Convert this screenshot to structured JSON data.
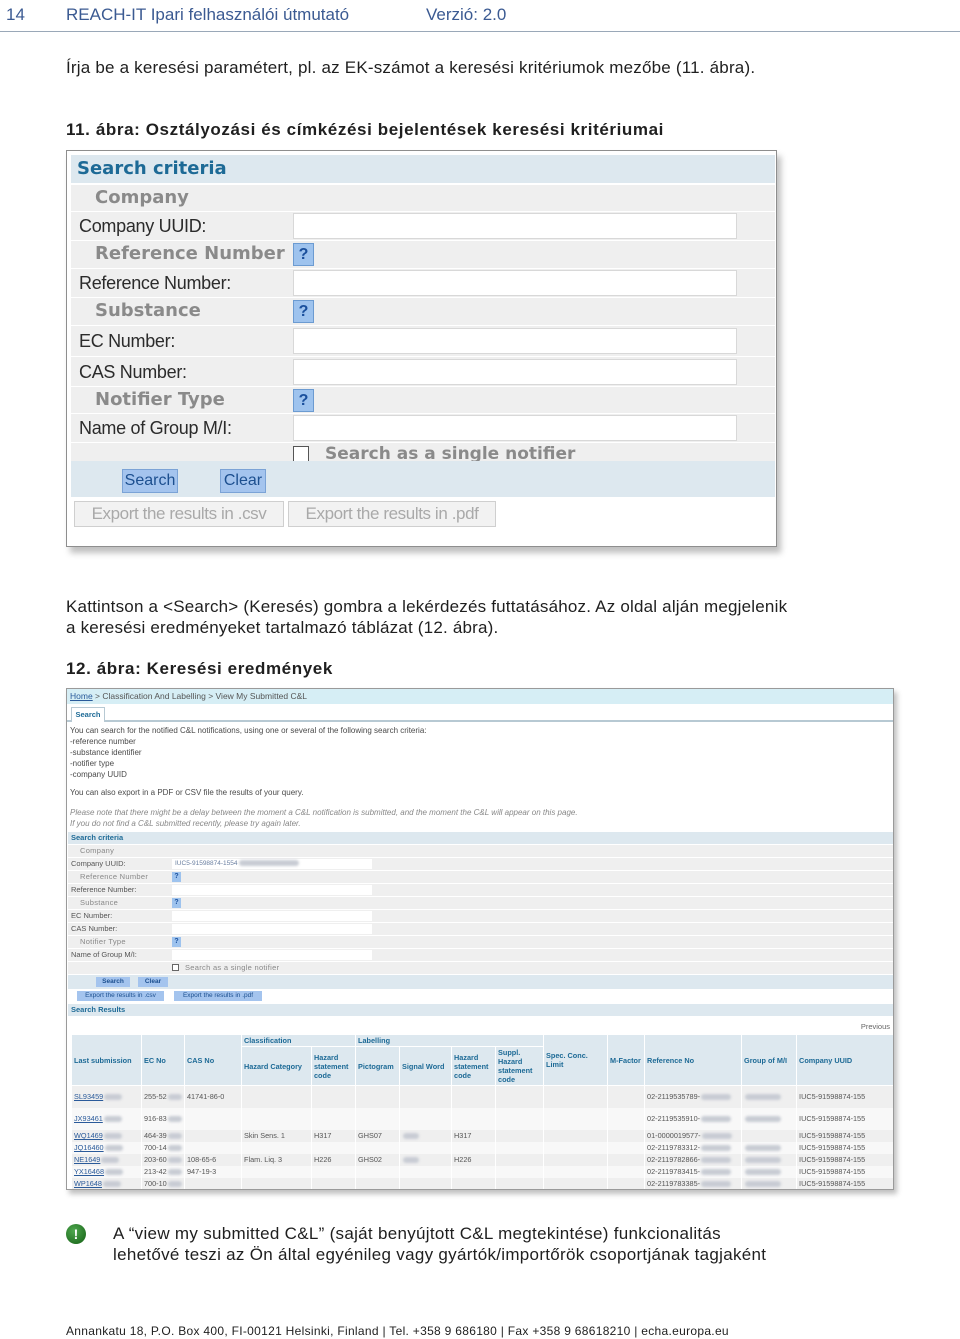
{
  "header": {
    "page_number": "14",
    "doc_title": "REACH-IT Ipari felhasználói útmutató",
    "version": "Verzió: 2.0"
  },
  "intro_text": "Írja be a keresési paramétert, pl. az EK-számot a keresési kritériumok mezőbe (11. ábra).",
  "figure11": {
    "caption": "11. ábra: Osztályozási és címkézési bejelentések keresési kritériumai",
    "title": "Search criteria",
    "sections": {
      "company": "Company",
      "reference": "Reference Number",
      "substance": "Substance",
      "notifier": "Notifier Type"
    },
    "labels": {
      "company_uuid": "Company UUID:",
      "reference_number": "Reference Number:",
      "ec_number": "EC Number:",
      "cas_number": "CAS Number:",
      "group_name": "Name of Group M/I:"
    },
    "values": {
      "company_uuid": "",
      "reference_number": "",
      "ec_number": "",
      "cas_number": "",
      "group_name": ""
    },
    "help_glyph": "?",
    "single_notifier_label": "Search as a single notifier",
    "single_notifier_checked": false,
    "search_button": "Search",
    "clear_button": "Clear",
    "export_csv": "Export the results in .csv",
    "export_pdf": "Export the results in .pdf"
  },
  "body_text": {
    "line1": "Kattintson a <Search> (Keresés) gombra a lekérdezés futtatásához. Az oldal alján megjelenik",
    "line2": "a keresési eredményeket tartalmazó táblázat (12. ábra)."
  },
  "figure12": {
    "caption": "12. ábra: Keresési eredmények",
    "breadcrumb": {
      "home": "Home",
      "rest": " > Classification And Labelling > View My Submitted C&L"
    },
    "tab": "Search",
    "intro_lines": [
      "You can search for the notified C&L notifications, using one or several of the following search criteria:",
      "-reference number",
      "-substance identifier",
      "-notifier type",
      "-company UUID"
    ],
    "export_note": "You can also export in a PDF or CSV file the results of your query.",
    "delay_note": [
      "Please note that there might be a delay between the moment a C&L notification is submitted, and the moment the C&L will appear on this page.",
      "If you do not find a C&L submitted recently, please try again later."
    ],
    "criteria": {
      "title": "Search criteria",
      "company": "Company",
      "company_uuid_label": "Company UUID:",
      "company_uuid_value": "IUC5-91598874-1554",
      "reference_section": "Reference Number",
      "reference_label": "Reference Number:",
      "substance_section": "Substance",
      "ec_label": "EC Number:",
      "cas_label": "CAS Number:",
      "notifier_section": "Notifier Type",
      "group_label": "Name of Group M/I:",
      "single_notifier": "Search as a single notifier",
      "search": "Search",
      "clear": "Clear",
      "export_csv": "Export the results in .csv",
      "export_pdf": "Export the results in .pdf",
      "help_glyph": "?"
    },
    "results": {
      "title": "Search Results",
      "previous": "Previous",
      "group_headers": {
        "classification": "Classification",
        "labelling": "Labelling"
      },
      "columns": [
        "Last submission",
        "EC No",
        "CAS No",
        "Hazard Category",
        "Hazard statement code",
        "Pictogram",
        "Signal Word",
        "Hazard statement code",
        "Suppl. Hazard statement code",
        "Spec. Conc. Limit",
        "M-Factor",
        "Reference No",
        "Group of M/I",
        "Company UUID"
      ],
      "rows": [
        {
          "last": "SL93459",
          "ec": "255-52",
          "cas": "41741-86-0",
          "hazcat": "",
          "hcode": "",
          "picto": "",
          "signal": "",
          "lcode": "",
          "suppl": "",
          "scl": "",
          "mf": "",
          "ref": "02-2119535789-",
          "group": "",
          "uuid": "IUC5-91598874-155"
        },
        {
          "last": "JX93461",
          "ec": "916-83",
          "cas": "",
          "hazcat": "",
          "hcode": "",
          "picto": "",
          "signal": "",
          "lcode": "",
          "suppl": "",
          "scl": "",
          "mf": "",
          "ref": "02-2119535910-",
          "group": "",
          "uuid": "IUC5-91598874-155"
        },
        {
          "last": "WQ1469",
          "ec": "464-39",
          "cas": "",
          "hazcat": "Skin Sens. 1",
          "hcode": "H317",
          "picto": "GHS07",
          "signal": "",
          "lcode": "H317",
          "suppl": "",
          "scl": "",
          "mf": "",
          "ref": "01-0000019577-",
          "group": "",
          "uuid": "IUC5-91598874-155"
        },
        {
          "last": "JQ16460",
          "ec": "700-14",
          "cas": "",
          "hazcat": "",
          "hcode": "",
          "picto": "",
          "signal": "",
          "lcode": "",
          "suppl": "",
          "scl": "",
          "mf": "",
          "ref": "02-2119783312-",
          "group": "",
          "uuid": "IUC5-91598874-155"
        },
        {
          "last": "NE1649",
          "ec": "203-60",
          "cas": "108-65-6",
          "hazcat": "Flam. Liq. 3",
          "hcode": "H226",
          "picto": "GHS02",
          "signal": "",
          "lcode": "H226",
          "suppl": "",
          "scl": "",
          "mf": "",
          "ref": "02-2119782866-",
          "group": "",
          "uuid": "IUC5-91598874-155"
        },
        {
          "last": "YX16468",
          "ec": "213-42",
          "cas": "947-19-3",
          "hazcat": "",
          "hcode": "",
          "picto": "",
          "signal": "",
          "lcode": "",
          "suppl": "",
          "scl": "",
          "mf": "",
          "ref": "02-2119783415-",
          "group": "",
          "uuid": "IUC5-91598874-155"
        },
        {
          "last": "WP1648",
          "ec": "700-10",
          "cas": "",
          "hazcat": "",
          "hcode": "",
          "picto": "",
          "signal": "",
          "lcode": "",
          "suppl": "",
          "scl": "",
          "mf": "",
          "ref": "02-2119783385-",
          "group": "",
          "uuid": "IUC5-91598874-155"
        }
      ]
    }
  },
  "note": {
    "icon": "!",
    "line1": "A “view my submitted C&L” (saját benyújtott C&L megtekintése) funkcionalitás",
    "line2": "lehetővé teszi az Ön által egyénileg vagy gyártók/importőrök csoportjának tagjaként"
  },
  "footer": "Annankatu 18, P.O. Box 400, FI-00121 Helsinki, Finland | Tel. +358 9 686180 | Fax +358 9 68618210 | echa.europa.eu"
}
